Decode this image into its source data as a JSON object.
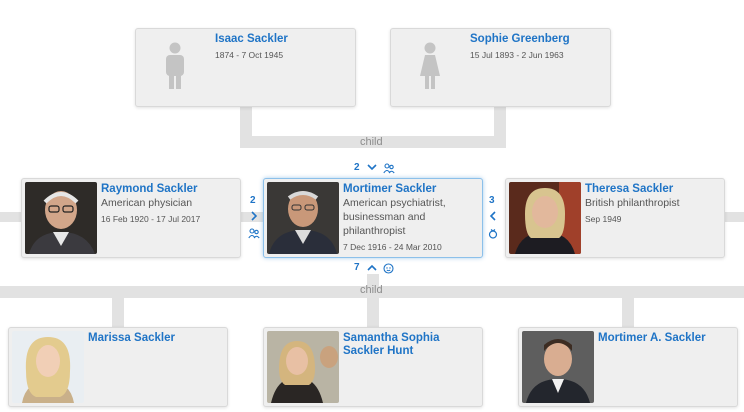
{
  "parents": [
    {
      "name": "Isaac Sackler",
      "dates": "1874 - 7 Oct 1945",
      "sex": "male"
    },
    {
      "name": "Sophie Greenberg",
      "dates": "15 Jul 1893 - 2 Jun 1963",
      "sex": "female"
    }
  ],
  "child_label_top": "child",
  "child_label_bottom": "child",
  "siblings": [
    {
      "name": "Raymond Sackler",
      "desc": "American physician",
      "dates": "16 Feb 1920 - 17 Jul 2017"
    },
    {
      "name": "Mortimer Sackler",
      "desc": "American psychiatrist, businessman and philanthropist",
      "dates": "7 Dec 1916 - 24 Mar 2010"
    }
  ],
  "spouse": {
    "name": "Theresa Sackler",
    "desc": "British philanthropist",
    "dates": "Sep 1949"
  },
  "counts": {
    "siblings_up": "2",
    "left_spouses": "2",
    "right_spouses": "3",
    "children": "7"
  },
  "children": [
    {
      "name": "Marissa Sackler"
    },
    {
      "name": "Samantha Sophia Sackler Hunt"
    },
    {
      "name": "Mortimer A. Sackler"
    }
  ],
  "colors": {
    "link": "#1f74c6",
    "card": "#efefef",
    "connector": "#e2e2e2",
    "selected_border": "#8cc0ea"
  }
}
